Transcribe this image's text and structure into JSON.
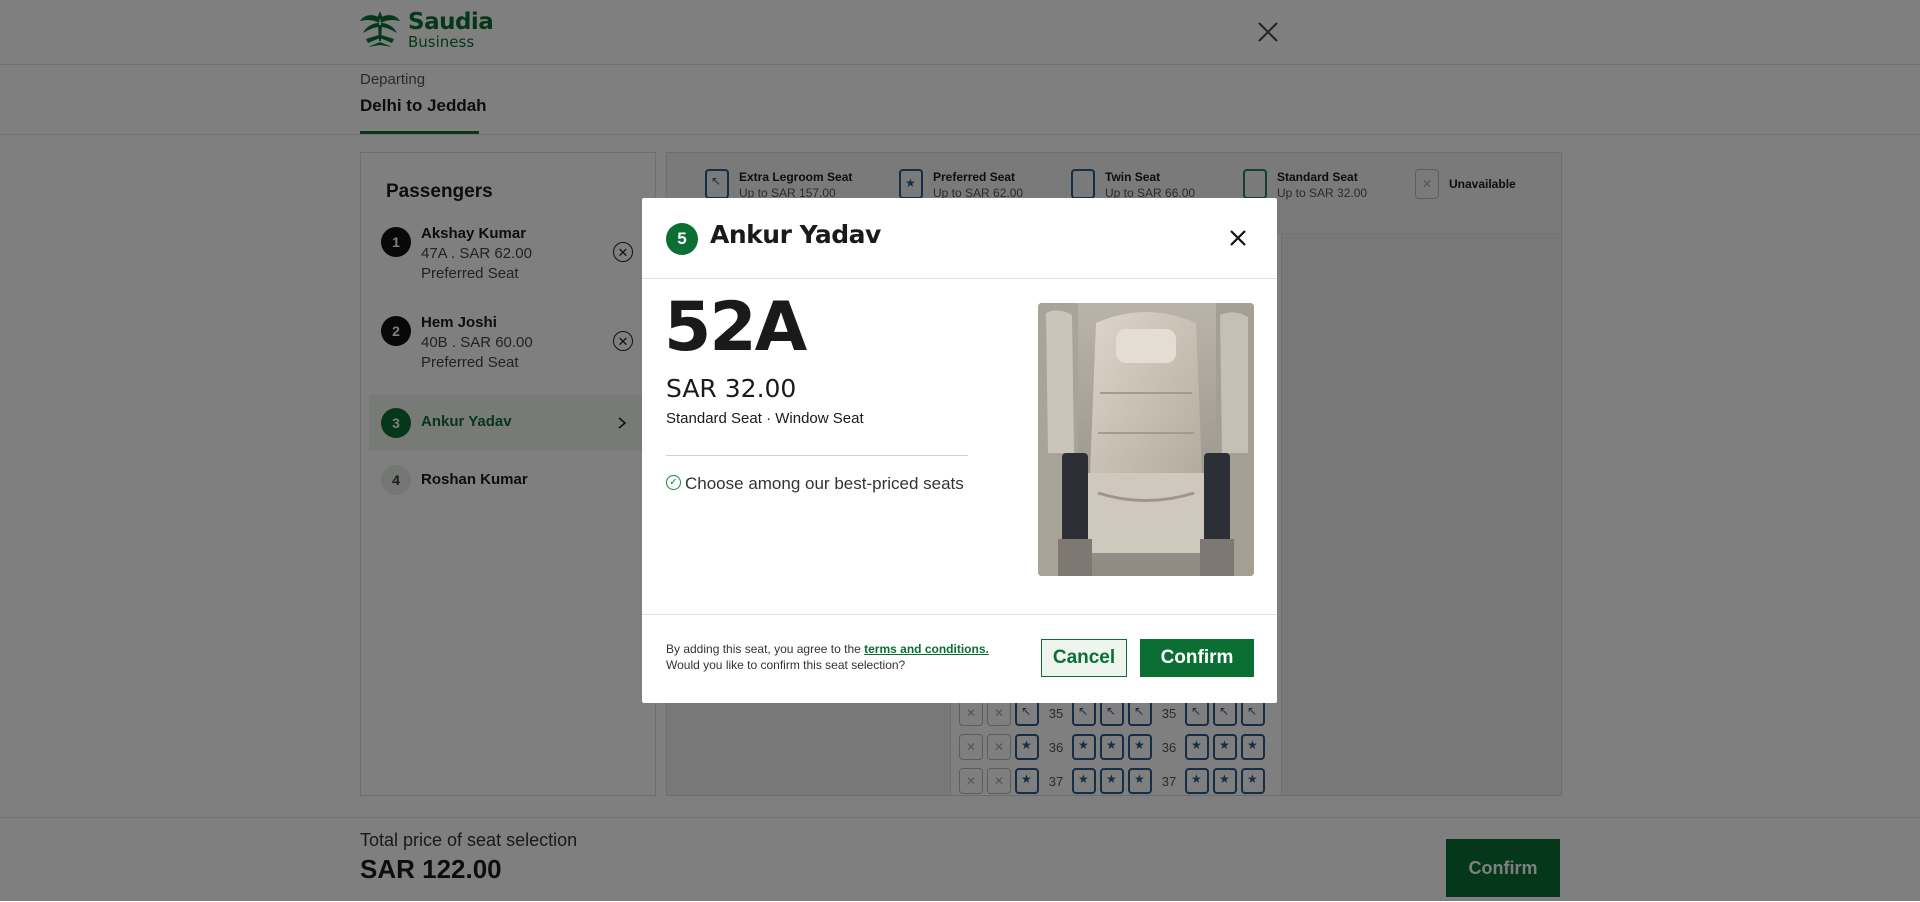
{
  "header": {
    "logo_brand": "Saudia",
    "logo_sub": "Business",
    "close_icon": "close-icon"
  },
  "tab": {
    "label": "Departing",
    "route": "Delhi to Jeddah"
  },
  "passengers": {
    "title": "Passengers",
    "items": [
      {
        "num": "1",
        "name": "Akshay Kumar",
        "seat_line": "47A . SAR  62.00",
        "type": "Preferred Seat"
      },
      {
        "num": "2",
        "name": "Hem Joshi",
        "seat_line": "40B . SAR  60.00",
        "type": "Preferred Seat"
      },
      {
        "num": "3",
        "name": "Ankur Yadav"
      },
      {
        "num": "4",
        "name": "Roshan Kumar"
      }
    ]
  },
  "legend": [
    {
      "title": "Extra Legroom Seat",
      "sub": "Up to SAR 157.00"
    },
    {
      "title": "Preferred Seat",
      "sub": "Up to SAR 62.00"
    },
    {
      "title": "Twin Seat",
      "sub": "Up to SAR 66.00"
    },
    {
      "title": "Standard Seat",
      "sub": "Up to SAR 32.00"
    },
    {
      "title": "Unavailable"
    }
  ],
  "seatmap": {
    "rows": [
      "35",
      "36",
      "37"
    ]
  },
  "footer": {
    "label": "Total price of seat selection",
    "total": "SAR 122.00",
    "confirm": "Confirm"
  },
  "modal": {
    "badge": "5",
    "name": "Ankur Yadav",
    "seat": "52A",
    "price": "SAR 32.00",
    "seat_type": "Standard Seat · Window Seat",
    "feature": "Choose among our best-priced seats",
    "terms_prefix": "By adding this seat, you agree to the ",
    "terms_link": "terms and conditions.",
    "terms_question": "Would you like to confirm this seat selection?",
    "cancel": "Cancel",
    "confirm": "Confirm"
  },
  "colors": {
    "brand": "#0b6f34",
    "seat_blue": "#2a5d8a"
  }
}
